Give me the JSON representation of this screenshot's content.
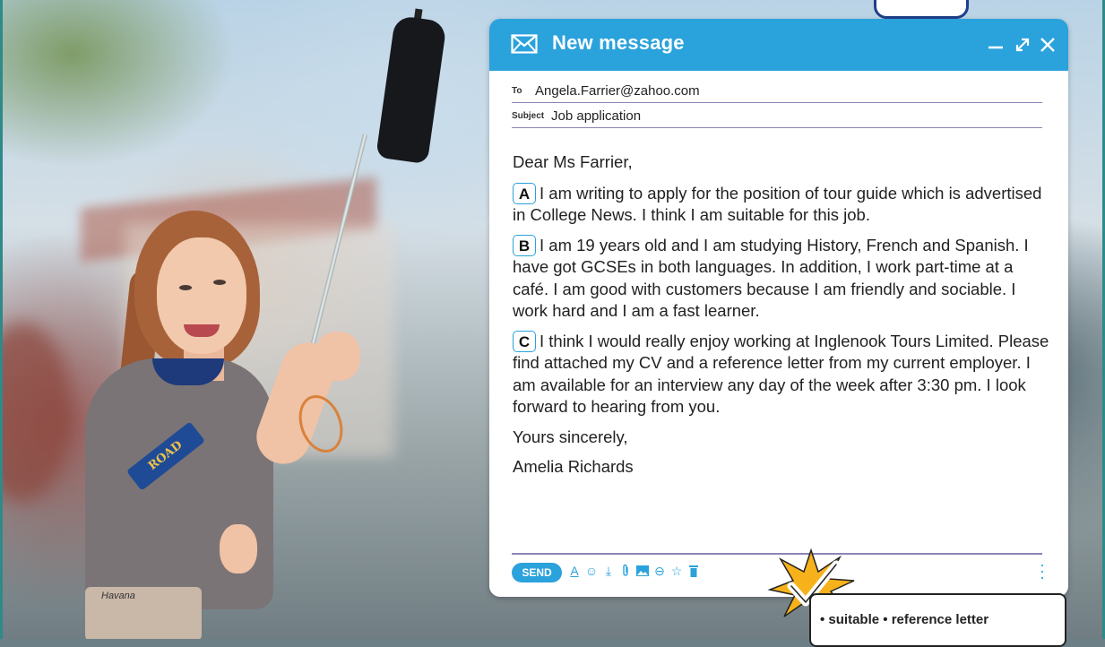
{
  "window": {
    "title": "New message",
    "controls": [
      "minimize-icon",
      "expand-icon",
      "close-icon"
    ],
    "accent_color": "#2aa2dc"
  },
  "fields": {
    "to_label": "To",
    "to_value": "Angela.Farrier@zahoo.com",
    "subject_label": "Subject",
    "subject_value": "Job application"
  },
  "letter": {
    "greeting": "Dear Ms Farrier,",
    "paragraphs": [
      {
        "badge": "A",
        "text": "I am writing to apply for the position of tour guide which is advertised in College News. I think I am suitable for this job."
      },
      {
        "badge": "B",
        "text": "I am 19 years old and I am studying History, French and Spanish. I have got GCSEs in both languages. In addition, I work part-time at a café. I am good with customers because I am friendly and sociable. I work hard and I am a fast learner."
      },
      {
        "badge": "C",
        "text": "I think I would really enjoy working at Inglenook Tours Limited. Please find attached my CV and a reference letter from my current employer. I am available for an interview any day of the week after 3:30 pm. I look forward to hearing from you."
      }
    ],
    "closing": "Yours sincerely,",
    "signature": "Amelia Richards"
  },
  "toolbar": {
    "send_label": "SEND",
    "tools": [
      "text-format-icon",
      "emoji-icon",
      "download-icon",
      "attach-icon",
      "image-icon",
      "link-icon",
      "star-icon",
      "trash-icon"
    ],
    "more": "⋮"
  },
  "tip": {
    "text": "• suitable  • reference letter"
  },
  "photo": {
    "sleeve_text_1": "ROAD",
    "sleeve_text_2": "ROAD",
    "skirt_text": "Havana"
  }
}
